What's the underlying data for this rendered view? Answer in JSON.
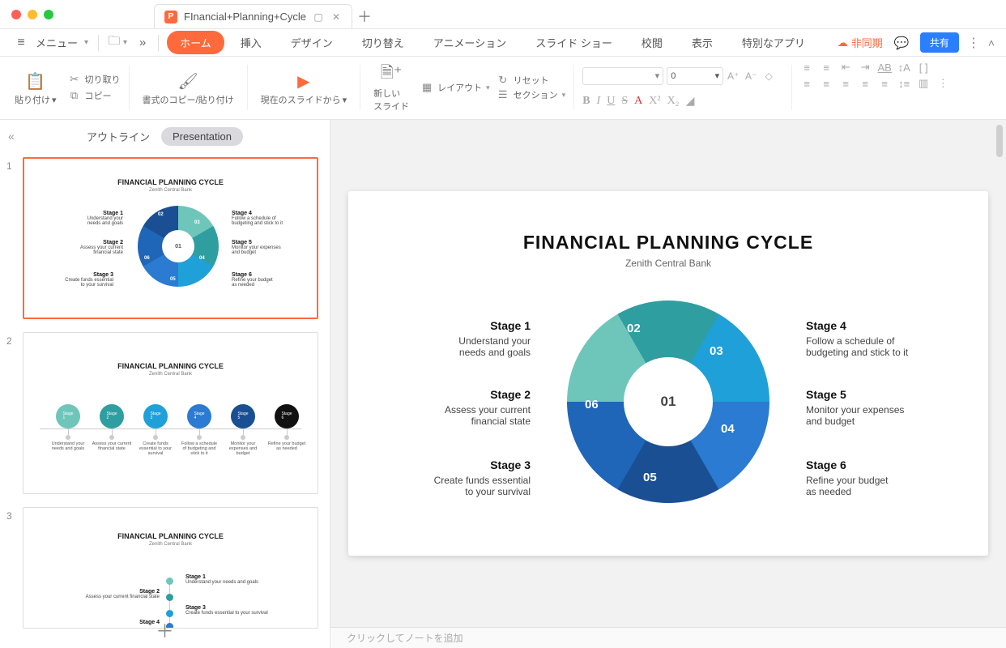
{
  "window": {
    "tab_title": "FInancial+Planning+Cycle"
  },
  "menu": {
    "label": "メニュー",
    "items": [
      "ホーム",
      "挿入",
      "デザイン",
      "切り替え",
      "アニメーション",
      "スライド ショー",
      "校閲",
      "表示",
      "特別なアプリ"
    ],
    "sync": "非同期",
    "share": "共有"
  },
  "ribbon": {
    "paste": "貼り付け",
    "cut": "切り取り",
    "copy": "コピー",
    "format_painter": "書式のコピー/貼り付け",
    "from_slide": "現在のスライドから",
    "new_slide": "新しい\nスライド",
    "layout": "レイアウト",
    "reset": "リセット",
    "section": "セクション",
    "font_size": "0"
  },
  "side": {
    "outline": "アウトライン",
    "presentation": "Presentation"
  },
  "notes_placeholder": "クリックしてノートを追加",
  "slide": {
    "title": "FINANCIAL PLANNING CYCLE",
    "subtitle": "Zenith Central Bank",
    "center": "01",
    "segments": [
      "02",
      "03",
      "04",
      "05",
      "06"
    ],
    "stages_left": [
      {
        "h": "Stage 1",
        "t": "Understand your\nneeds and goals"
      },
      {
        "h": "Stage 2",
        "t": "Assess your current\nfinancial state"
      },
      {
        "h": "Stage 3",
        "t": "Create funds essential\nto your survival"
      }
    ],
    "stages_right": [
      {
        "h": "Stage 4",
        "t": "Follow a schedule of\nbudgeting and stick to it"
      },
      {
        "h": "Stage 5",
        "t": "Monitor your expenses\nand budget"
      },
      {
        "h": "Stage 6",
        "t": "Refine your budget\nas needed"
      }
    ]
  },
  "thumb2": {
    "nodes": [
      "Stage\n1",
      "Stage\n2",
      "Stage\n3",
      "Stage\n4",
      "Stage\n5",
      "Stage\n6"
    ],
    "labels": [
      "Understand your needs and goals",
      "Assess your current financial state",
      "Create funds essential to your survival",
      "Follow a schedule of budgeting and stick to it",
      "Monitor your expenses and budget",
      "Refine your budget as needed"
    ]
  },
  "thumb3": {
    "left": [
      {
        "h": "Stage 2",
        "t": "Assess your current financial state"
      },
      {
        "h": "Stage 4",
        "t": ""
      }
    ],
    "right": [
      {
        "h": "Stage 1",
        "t": "Understand your needs and goals"
      },
      {
        "h": "Stage 3",
        "t": "Create funds essential to your survival"
      }
    ]
  },
  "colors": {
    "seg": [
      "#6ec6bb",
      "#2f9ea0",
      "#1fa0d8",
      "#2a7bd1",
      "#1f66b8",
      "#1a4f93"
    ]
  }
}
